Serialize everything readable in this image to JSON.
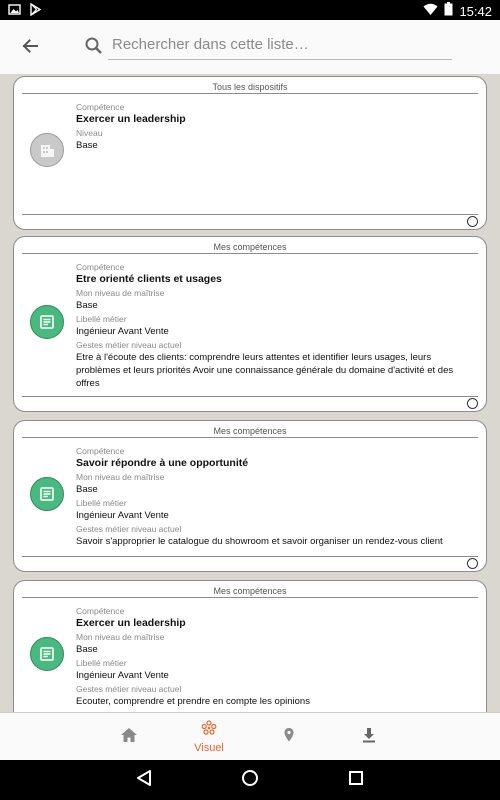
{
  "status_bar": {
    "time": "15:42"
  },
  "search": {
    "placeholder": "Rechercher dans cette liste…"
  },
  "cards": [
    {
      "header": "Tous les dispositifs",
      "icon": "building-icon",
      "fields": [
        {
          "label": "Compétence",
          "value": "Exercer un leadership"
        },
        {
          "label": "Niveau",
          "value": "Base"
        }
      ]
    },
    {
      "header": "Mes compétences",
      "icon": "document-icon",
      "fields": [
        {
          "label": "Compétence",
          "value": "Etre orienté clients et usages"
        },
        {
          "label": "Mon niveau de maîtrise",
          "value": "Base"
        },
        {
          "label": "Libellé métier",
          "value": "Ingénieur Avant Vente"
        },
        {
          "label": "Gestes métier niveau actuel",
          "value": "Etre à l'écoute des clients: comprendre leurs attentes et identifier leurs usages, leurs problèmes et leurs priorités Avoir une connaissance générale du domaine d'activité et des offres"
        }
      ]
    },
    {
      "header": "Mes compétences",
      "icon": "document-icon",
      "fields": [
        {
          "label": "Compétence",
          "value": "Savoir répondre à une opportunité"
        },
        {
          "label": "Mon niveau de maîtrise",
          "value": "Base"
        },
        {
          "label": "Libellé métier",
          "value": "Ingénieur Avant Vente"
        },
        {
          "label": "Gestes métier niveau actuel",
          "value": "Savoir s'approprier le catalogue du showroom et savoir organiser un rendez-vous client"
        }
      ]
    },
    {
      "header": "Mes compétences",
      "icon": "document-icon",
      "fields": [
        {
          "label": "Compétence",
          "value": "Exercer un leadership"
        },
        {
          "label": "Mon niveau de maîtrise",
          "value": "Base"
        },
        {
          "label": "Libellé métier",
          "value": "Ingénieur Avant Vente"
        },
        {
          "label": "Gestes métier niveau actuel",
          "value": "Ecouter, comprendre et prendre en compte les opinions"
        }
      ]
    }
  ],
  "bottom_nav": {
    "items": [
      {
        "icon": "home-icon",
        "label": ""
      },
      {
        "icon": "flower-icon",
        "label": "Visuel"
      },
      {
        "icon": "location-pin-icon",
        "label": ""
      },
      {
        "icon": "download-icon",
        "label": ""
      }
    ],
    "active_color": "#e8672a",
    "inactive_color": "#8a8a8a"
  },
  "colors": {
    "background": "#dad6d0",
    "icon_green": "#49b97f",
    "icon_grey": "#c9c9c9"
  }
}
